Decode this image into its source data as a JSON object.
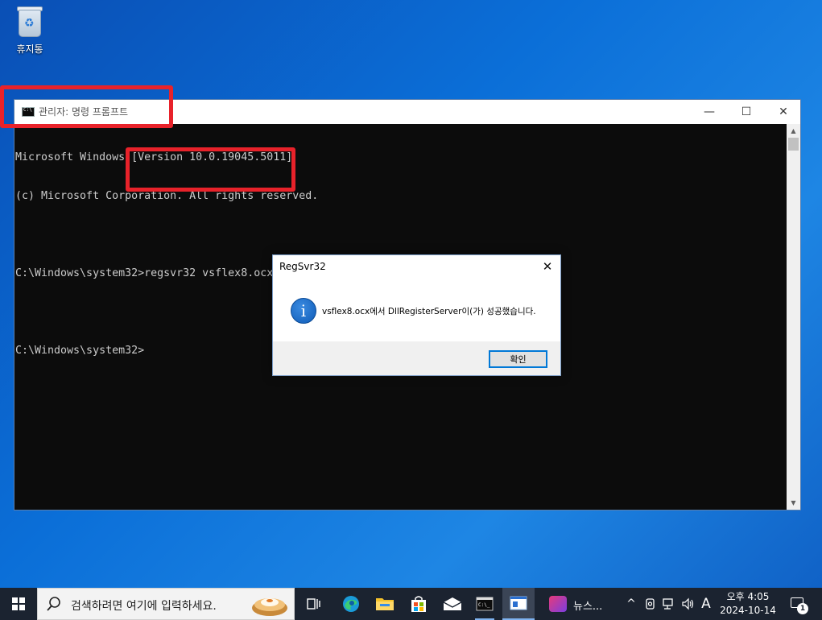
{
  "desktop": {
    "recycle_bin_label": "휴지통",
    "recycle_bin_icon": "recycle-bin-icon"
  },
  "cmd_window": {
    "title": "관리자: 명령 프롬프트",
    "minimize_glyph": "—",
    "maximize_glyph": "☐",
    "close_glyph": "✕",
    "console_lines": [
      "Microsoft Windows [Version 10.0.19045.5011]",
      "(c) Microsoft Corporation. All rights reserved.",
      "",
      "C:\\Windows\\system32>regsvr32 vsflex8.ocx",
      "",
      "C:\\Windows\\system32>"
    ],
    "scroll_up_glyph": "▲",
    "scroll_down_glyph": "▼"
  },
  "dialog": {
    "title": "RegSvr32",
    "close_glyph": "✕",
    "icon": "information-icon",
    "icon_glyph": "i",
    "message": "vsflex8.ocx에서 DllRegisterServer이(가) 성공했습니다.",
    "ok_label": "확인"
  },
  "taskbar": {
    "search_placeholder": "검색하려면 여기에 입력하세요.",
    "news_label": "뉴스...",
    "tray_chevron": "^",
    "ime_label": "A",
    "clock_time": "오후 4:05",
    "clock_date": "2024-10-14",
    "notification_count": "1"
  },
  "colors": {
    "annotation_red": "#e8222a",
    "console_bg": "#0c0c0c",
    "console_text": "#cccccc",
    "taskbar_bg": "#1b2330",
    "accent": "#0078d7"
  }
}
